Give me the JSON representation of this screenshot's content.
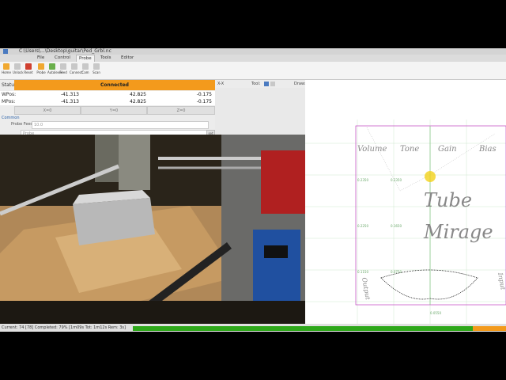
{
  "window": {
    "title": "C:\\Users\\...\\Desktop\\guitar\\Ped_Grbl.nc"
  },
  "ribbon": {
    "tabs": [
      "File",
      "Control",
      "Probe",
      "Tools",
      "Editor"
    ],
    "active_tab": "Probe",
    "buttons": [
      "Home",
      "Unlock",
      "Reset",
      "Probe",
      "Autolevel",
      "Feed",
      "Connect",
      "Cam",
      "Scan"
    ]
  },
  "status": {
    "label": "Status:",
    "value": "Connected"
  },
  "positions": {
    "wpos": {
      "label": "WPos:",
      "x": "-41.313",
      "y": "42.825",
      "z": "-0.175"
    },
    "mpos": {
      "label": "MPos:",
      "x": "-41.313",
      "y": "42.825",
      "z": "-0.175"
    }
  },
  "zero_buttons": [
    "X=0",
    "Y=0",
    "Z=0"
  ],
  "common": {
    "section": "Common",
    "probe_feed_label": "Probe Feed:",
    "probe_feed_value": "10.0",
    "probe_button": "Probe",
    "set_button": "set"
  },
  "toolbar": {
    "x_label": "X-X",
    "tool_label": "Tool:",
    "draw_label": "Draw:"
  },
  "statusbar": {
    "text": "Current: 74 [78]  Completed: 79% [1m09s Tot: 1m12s Rem: 3s]"
  },
  "progress": {
    "completed_fraction": 0.91
  },
  "canvas": {
    "labels": [
      "Volume",
      "Tone",
      "Gain",
      "Bias"
    ],
    "script_lines": [
      "Tube",
      "Mirage"
    ],
    "side_labels": [
      "Output",
      "Input"
    ],
    "grid_labels": [
      "0.2350",
      "0.2350",
      "0.2250",
      "0.1650",
      "0.1150",
      "0.0750",
      "0.0550"
    ],
    "colors": {
      "border": "#c040c0",
      "grid": "#cfe8cf",
      "text": "#888888",
      "path": "#111111",
      "cursor": "#f2d21a"
    }
  },
  "colors": {
    "status_bg": "#f39a1c",
    "progress_fill": "#2ea81a",
    "progress_remaining": "#f39a1c"
  }
}
